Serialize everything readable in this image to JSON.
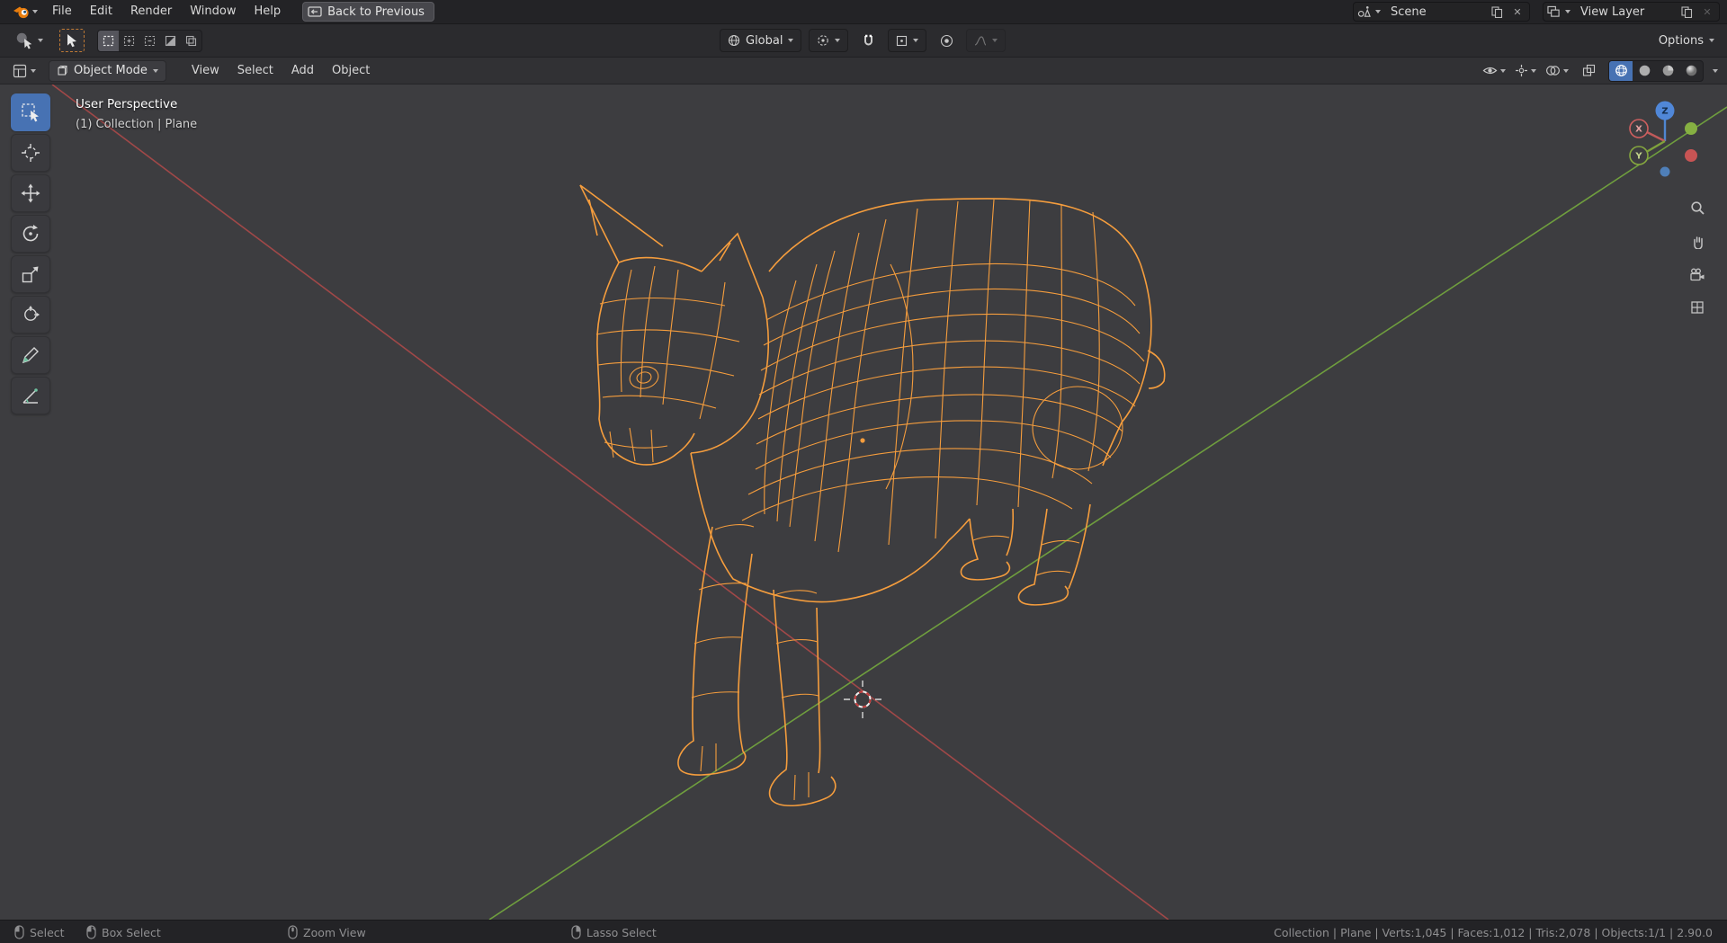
{
  "colors": {
    "wireframe_orange": "#f59d3d",
    "axis_x_red": "#a04848",
    "axis_y_green": "#6f9e3e",
    "accent_active": "#4772b3",
    "topbar_bg": "#232326",
    "viewport_bg": "#3d3d40",
    "gizmo_z_blue": "#5087d8",
    "gizmo_x_red": "#cf5f5f",
    "gizmo_y_green": "#86a83f"
  },
  "icons": {
    "close-icon": "✕",
    "caret-down-icon": "▾"
  },
  "topbar": {
    "menu_file": "File",
    "menu_edit": "Edit",
    "menu_render": "Render",
    "menu_window": "Window",
    "menu_help": "Help",
    "back_button_label": "Back to Previous",
    "scene_selector": {
      "label": "Scene"
    },
    "view_layer_selector": {
      "label": "View Layer"
    }
  },
  "tool_header": {
    "orientation_label": "Global",
    "options_label": "Options"
  },
  "viewport_header": {
    "mode_label": "Object Mode",
    "menu_view": "View",
    "menu_select": "Select",
    "menu_add": "Add",
    "menu_object": "Object"
  },
  "viewport": {
    "perspective_label": "User Perspective",
    "context_label": "(1) Collection | Plane"
  },
  "gizmo": {
    "x_label": "X",
    "y_label": "Y",
    "z_label": "Z"
  },
  "statusbar": {
    "hint_select": "Select",
    "hint_box_select": "Box Select",
    "hint_zoom_view": "Zoom View",
    "hint_lasso_select": "Lasso Select",
    "stats": "Collection | Plane | Verts:1,045 | Faces:1,012 | Tris:2,078 | Objects:1/1 | 2.90.0"
  }
}
